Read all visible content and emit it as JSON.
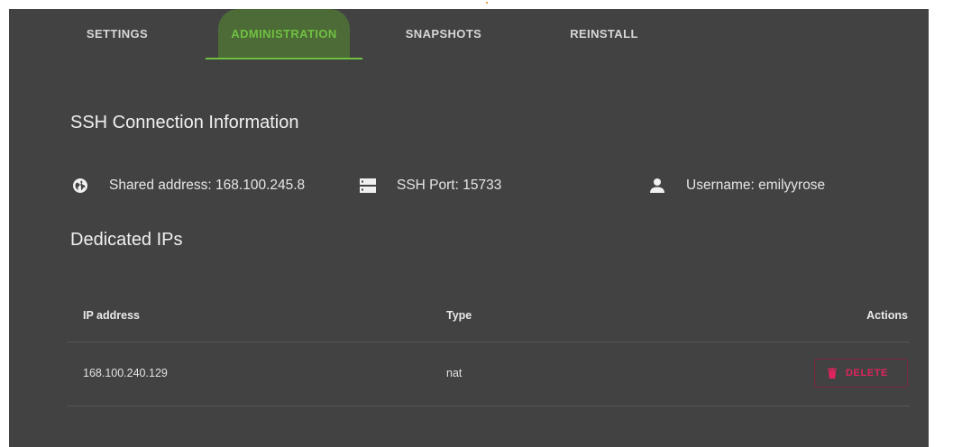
{
  "tabs": [
    {
      "label": "SETTINGS"
    },
    {
      "label": "ADMINISTRATION",
      "active": true
    },
    {
      "label": "SNAPSHOTS"
    },
    {
      "label": "REINSTALL"
    }
  ],
  "ssh": {
    "title": "SSH Connection Information",
    "shared_address": "Shared address: 168.100.245.8",
    "port": "SSH Port: 15733",
    "username": "Username: emilyyrose"
  },
  "dedicated_ips": {
    "title": "Dedicated IPs",
    "columns": [
      "IP address",
      "Type",
      "Actions"
    ],
    "rows": [
      {
        "ip": "168.100.240.129",
        "type": "nat",
        "action": "DELETE"
      }
    ]
  },
  "colors": {
    "panel": "#424242",
    "accent": "#6fc043",
    "danger": "#e0245c"
  },
  "icons": {
    "shared_address": "globe-icon",
    "port": "server-icon",
    "username": "person-icon",
    "delete": "trash-icon"
  }
}
